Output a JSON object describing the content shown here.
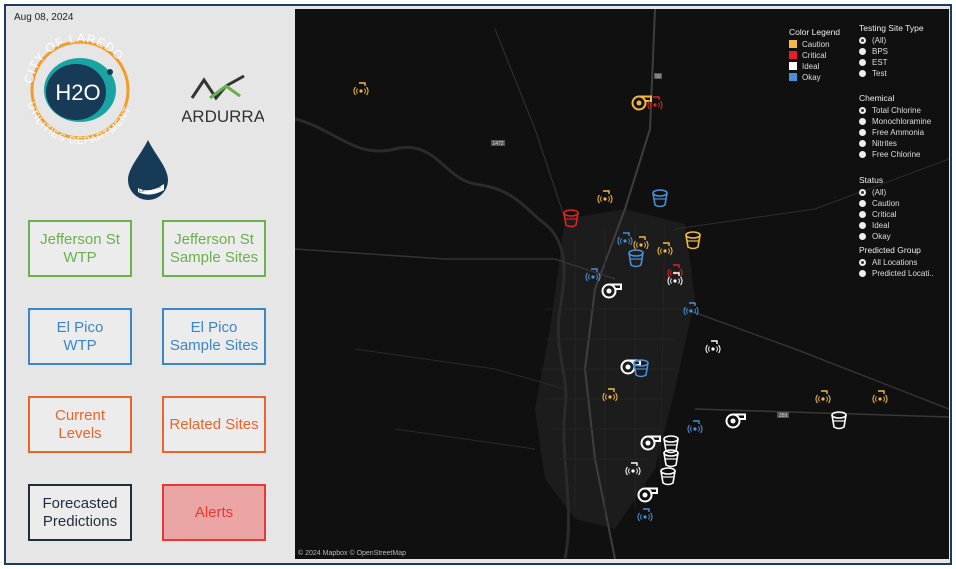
{
  "date": "Aug 08, 2024",
  "logos": {
    "city_arc_top": "CITY OF LAREDO",
    "city_arc_bottom": "UTILITIES DEPARTMENT",
    "h2o": "H2O",
    "ardurra": "ARDURRA",
    "drop_text": "La Placita"
  },
  "buttons": {
    "jefferson_wtp": "Jefferson St\nWTP",
    "jefferson_samples": "Jefferson St\nSample Sites",
    "elpico_wtp": "El Pico\nWTP",
    "elpico_samples": "El Pico\nSample Sites",
    "current_levels": "Current\nLevels",
    "related_sites": "Related Sites",
    "forecasted": "Forecasted\nPredictions",
    "alerts": "Alerts"
  },
  "colors": {
    "caution": "#f4b942",
    "critical": "#e52020",
    "ideal": "#ffffff",
    "okay": "#4a90d9"
  },
  "map": {
    "attribution": "© 2024 Mapbox © OpenStreetMap",
    "road_labels": [
      "1472",
      "59",
      "359"
    ]
  },
  "legend": {
    "title": "Color Legend",
    "items": [
      "Caution",
      "Critical",
      "Ideal",
      "Okay"
    ]
  },
  "filters": {
    "site_type": {
      "title": "Testing Site Type",
      "options": [
        "(All)",
        "BPS",
        "EST",
        "Test"
      ],
      "selected": "(All)"
    },
    "chemical": {
      "title": "Chemical",
      "options": [
        "Total Chlorine",
        "Monochloramine",
        "Free Ammonia",
        "Nitrites",
        "Free Chlorine"
      ],
      "selected": "Total Chlorine"
    },
    "status": {
      "title": "Status",
      "options": [
        "(All)",
        "Caution",
        "Critical",
        "Ideal",
        "Okay"
      ],
      "selected": "(All)"
    },
    "predicted": {
      "title": "Predicted Group",
      "options": [
        "All Locations",
        "Predicted Locati.."
      ],
      "selected": "All Locations"
    }
  },
  "markers": [
    {
      "kind": "test",
      "status": "caution",
      "icon": "test-site-icon"
    },
    {
      "kind": "bps",
      "status": "caution",
      "icon": "pump-station-icon"
    },
    {
      "kind": "test",
      "status": "critical",
      "icon": "test-site-icon"
    },
    {
      "kind": "test",
      "status": "caution",
      "icon": "test-site-icon"
    },
    {
      "kind": "est",
      "status": "critical",
      "icon": "storage-tank-icon"
    },
    {
      "kind": "est",
      "status": "okay",
      "icon": "storage-tank-icon"
    },
    {
      "kind": "test",
      "status": "okay",
      "icon": "test-site-icon"
    },
    {
      "kind": "test",
      "status": "caution",
      "icon": "test-site-icon"
    },
    {
      "kind": "test",
      "status": "caution",
      "icon": "test-site-icon"
    },
    {
      "kind": "est",
      "status": "caution",
      "icon": "storage-tank-icon"
    },
    {
      "kind": "est",
      "status": "okay",
      "icon": "storage-tank-icon"
    },
    {
      "kind": "test",
      "status": "okay",
      "icon": "test-site-icon"
    },
    {
      "kind": "test",
      "status": "critical",
      "icon": "test-site-icon"
    },
    {
      "kind": "test",
      "status": "ideal",
      "icon": "test-site-icon"
    },
    {
      "kind": "bps",
      "status": "ideal",
      "icon": "pump-station-icon"
    },
    {
      "kind": "test",
      "status": "okay",
      "icon": "test-site-icon"
    },
    {
      "kind": "test",
      "status": "ideal",
      "icon": "test-site-icon"
    },
    {
      "kind": "bps",
      "status": "ideal",
      "icon": "pump-station-icon"
    },
    {
      "kind": "est",
      "status": "okay",
      "icon": "storage-tank-icon"
    },
    {
      "kind": "test",
      "status": "caution",
      "icon": "test-site-icon"
    },
    {
      "kind": "test",
      "status": "caution",
      "icon": "test-site-icon"
    },
    {
      "kind": "test",
      "status": "caution",
      "icon": "test-site-icon"
    },
    {
      "kind": "est",
      "status": "ideal",
      "icon": "storage-tank-icon"
    },
    {
      "kind": "test",
      "status": "okay",
      "icon": "test-site-icon"
    },
    {
      "kind": "bps",
      "status": "ideal",
      "icon": "pump-station-icon"
    },
    {
      "kind": "bps",
      "status": "ideal",
      "icon": "pump-station-icon"
    },
    {
      "kind": "est",
      "status": "ideal",
      "icon": "storage-tank-icon"
    },
    {
      "kind": "est",
      "status": "ideal",
      "icon": "storage-tank-icon"
    },
    {
      "kind": "test",
      "status": "ideal",
      "icon": "test-site-icon"
    },
    {
      "kind": "est",
      "status": "ideal",
      "icon": "storage-tank-icon"
    },
    {
      "kind": "bps",
      "status": "ideal",
      "icon": "pump-station-icon"
    },
    {
      "kind": "test",
      "status": "okay",
      "icon": "test-site-icon"
    }
  ]
}
